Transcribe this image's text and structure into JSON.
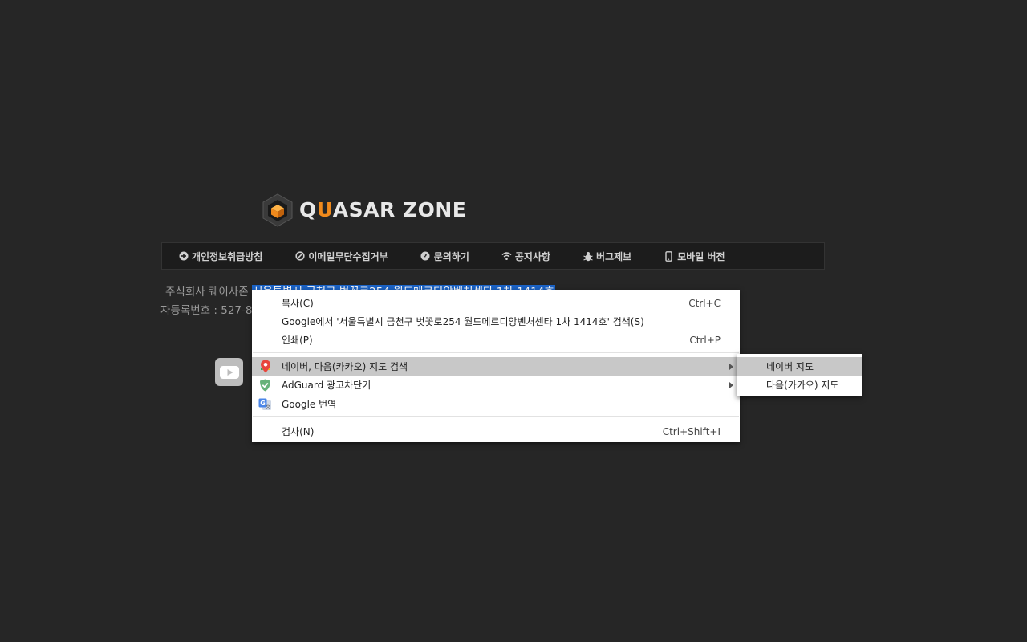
{
  "logo": {
    "text_accent": "U",
    "text_pre": "Q",
    "text_post": "ASAR ZONE"
  },
  "footer_nav": [
    {
      "label": "개인정보취급방침",
      "icon": "plus-circle-icon"
    },
    {
      "label": "이메일무단수집거부",
      "icon": "ban-icon"
    },
    {
      "label": "문의하기",
      "icon": "question-circle-icon"
    },
    {
      "label": "공지사항",
      "icon": "wifi-icon"
    },
    {
      "label": "버그제보",
      "icon": "bug-icon"
    },
    {
      "label": "모바일 버전",
      "icon": "mobile-icon"
    }
  ],
  "company": {
    "prefix": "주식회사 퀘이사존 ",
    "selected_address": "서울특별시 금천구 벚꽃로254 월드메르디앙벤처센타 1차 1414호",
    "line2": "자등록번호 : 527-8"
  },
  "context_menu": {
    "items": [
      {
        "label": "복사(C)",
        "shortcut": "Ctrl+C"
      },
      {
        "label": "Google에서 '서울특별시 금천구 벚꽃로254 월드메르디앙벤처센타 1차 1414호' 검색(S)",
        "shortcut": ""
      },
      {
        "label": "인쇄(P)",
        "shortcut": "Ctrl+P"
      },
      {
        "label": "네이버, 다음(카카오) 지도 검색",
        "icon": "map-pin-icon",
        "submenu": true,
        "highlighted": true
      },
      {
        "label": "AdGuard 광고차단기",
        "icon": "adguard-shield-icon",
        "submenu": true
      },
      {
        "label": "Google 번역",
        "icon": "google-translate-icon"
      },
      {
        "label": "검사(N)",
        "shortcut": "Ctrl+Shift+I"
      }
    ]
  },
  "submenu": {
    "items": [
      {
        "label": "네이버 지도",
        "highlighted": true
      },
      {
        "label": "다음(카카오) 지도"
      }
    ]
  },
  "colors": {
    "background": "#262626",
    "accent": "#f08a1c",
    "selection": "#1b63c6"
  }
}
